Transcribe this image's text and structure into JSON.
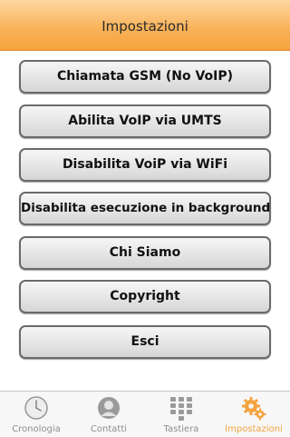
{
  "navbar": {
    "title": "Impostazioni"
  },
  "buttons": [
    {
      "label": "Chiamata GSM (No VoIP)"
    },
    {
      "label": "Abilita VoIP via UMTS"
    },
    {
      "label": "Disabilita VoiP via WiFi"
    },
    {
      "label": "Disabilita esecuzione in background"
    },
    {
      "label": "Chi Siamo"
    },
    {
      "label": "Copyright"
    },
    {
      "label": "Esci"
    }
  ],
  "tabbar": {
    "active_color": "#f4a340",
    "inactive_color": "#8e8e8e",
    "tabs": [
      {
        "label": "Cronologia",
        "icon": "clock-icon",
        "active": false
      },
      {
        "label": "Contatti",
        "icon": "person-icon",
        "active": false
      },
      {
        "label": "Tastiera",
        "icon": "keypad-icon",
        "active": false
      },
      {
        "label": "Impostazioni",
        "icon": "gears-icon",
        "active": true
      }
    ]
  }
}
